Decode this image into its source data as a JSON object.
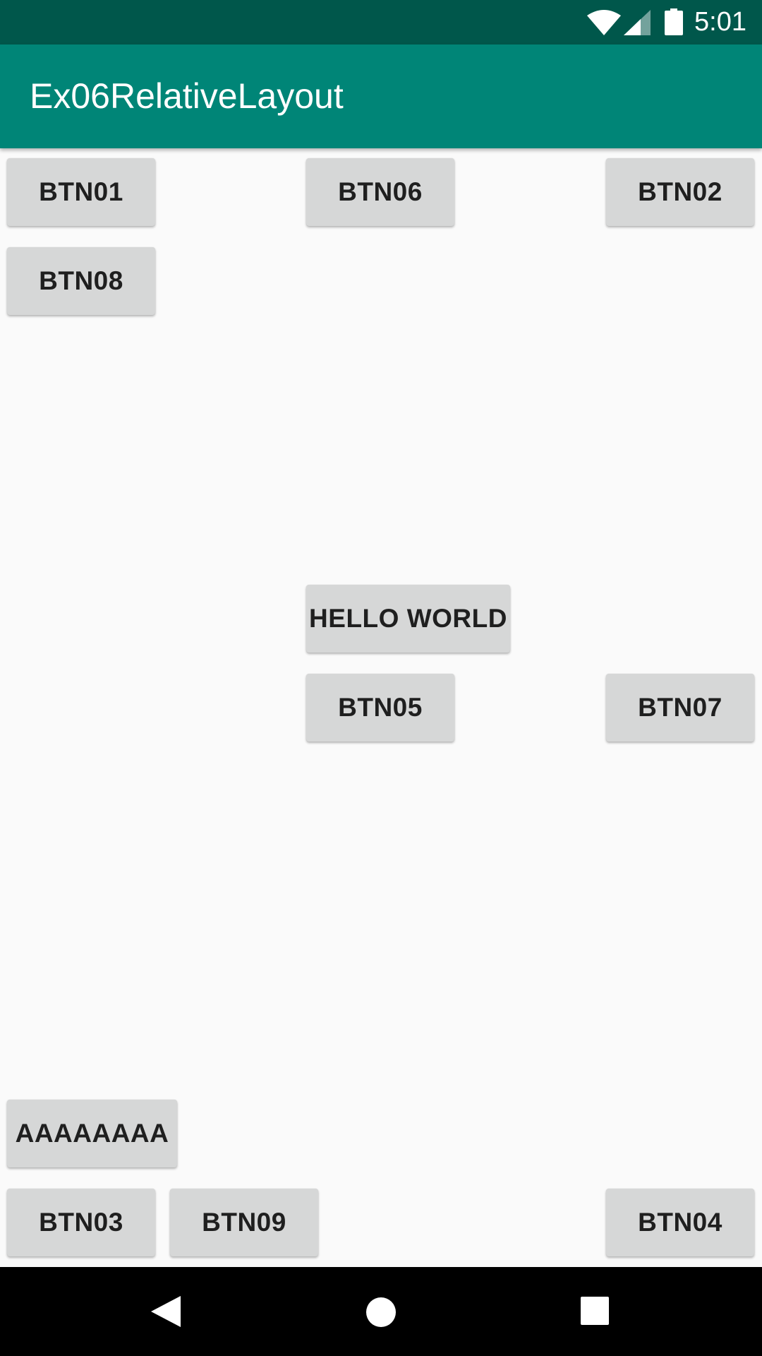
{
  "status_bar": {
    "time": "5:01",
    "icons": [
      "wifi-icon",
      "cell-signal-icon",
      "battery-icon"
    ],
    "background": "#00574b"
  },
  "app_bar": {
    "title": "Ex06RelativeLayout",
    "background": "#008577"
  },
  "buttons": {
    "btn01": "BTN01",
    "btn06": "BTN06",
    "btn02": "BTN02",
    "btn08": "BTN08",
    "hello_world": "HELLO WORLD",
    "btn05": "BTN05",
    "btn07": "BTN07",
    "aaaaaaaa": "AAAAAAAA",
    "btn03": "BTN03",
    "btn09": "BTN09",
    "btn04": "BTN04"
  },
  "nav_bar": {
    "icons": [
      "back-icon",
      "home-icon",
      "recents-icon"
    ],
    "background": "#000000"
  },
  "colors": {
    "content_background": "#fafafa",
    "button_background": "#d6d7d7",
    "button_text": "#1f1f1f"
  }
}
